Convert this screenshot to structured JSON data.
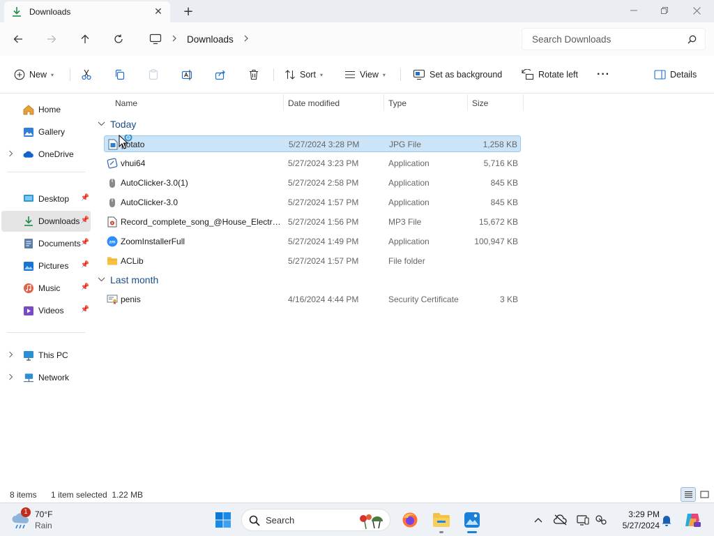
{
  "window": {
    "tab_title": "Downloads",
    "tab_close": "✕",
    "new_tab": "+"
  },
  "address": {
    "breadcrumb": "Downloads",
    "search_placeholder": "Search Downloads"
  },
  "commands": {
    "new": "New",
    "sort": "Sort",
    "view": "View",
    "set_background": "Set as background",
    "rotate_left": "Rotate left",
    "more": "···",
    "details": "Details"
  },
  "sidebar": {
    "items": [
      {
        "label": "Home"
      },
      {
        "label": "Gallery"
      },
      {
        "label": "OneDrive"
      },
      {
        "label": "Desktop"
      },
      {
        "label": "Downloads"
      },
      {
        "label": "Documents"
      },
      {
        "label": "Pictures"
      },
      {
        "label": "Music"
      },
      {
        "label": "Videos"
      },
      {
        "label": "This PC"
      },
      {
        "label": "Network"
      }
    ]
  },
  "columns": {
    "name": "Name",
    "date": "Date modified",
    "type": "Type",
    "size": "Size"
  },
  "groups": {
    "today": "Today",
    "last_month": "Last month"
  },
  "files": [
    {
      "name": "potato",
      "date": "5/27/2024 3:28 PM",
      "type": "JPG File",
      "size": "1,258 KB",
      "icon": "image-icon"
    },
    {
      "name": "vhui64",
      "date": "5/27/2024 3:23 PM",
      "type": "Application",
      "size": "5,716 KB",
      "icon": "app-icon"
    },
    {
      "name": "AutoClicker-3.0(1)",
      "date": "5/27/2024 2:58 PM",
      "type": "Application",
      "size": "845 KB",
      "icon": "mouse-icon"
    },
    {
      "name": "AutoClicker-3.0",
      "date": "5/27/2024 1:57 PM",
      "type": "Application",
      "size": "845 KB",
      "icon": "mouse-icon"
    },
    {
      "name": "Record_complete_song_@House_Electro...",
      "date": "5/27/2024 1:56 PM",
      "type": "MP3 File",
      "size": "15,672 KB",
      "icon": "audio-icon"
    },
    {
      "name": "ZoomInstallerFull",
      "date": "5/27/2024 1:49 PM",
      "type": "Application",
      "size": "100,947 KB",
      "icon": "zoom-icon"
    },
    {
      "name": "ACLib",
      "date": "5/27/2024 1:57 PM",
      "type": "File folder",
      "size": "",
      "icon": "folder-icon"
    }
  ],
  "files_last_month": [
    {
      "name": "penis",
      "date": "4/16/2024 4:44 PM",
      "type": "Security Certificate",
      "size": "3 KB",
      "icon": "certificate-icon"
    }
  ],
  "status": {
    "count": "8 items",
    "selection": "1 item selected  1.22 MB"
  },
  "taskbar": {
    "weather_temp": "70°F",
    "weather_cond": "Rain",
    "weather_badge": "1",
    "search": "Search",
    "time": "3:29 PM",
    "date": "5/27/2024"
  },
  "colors": {
    "accent": "#0067c0",
    "selection": "#cce4f7",
    "folder": "#f5c043"
  }
}
